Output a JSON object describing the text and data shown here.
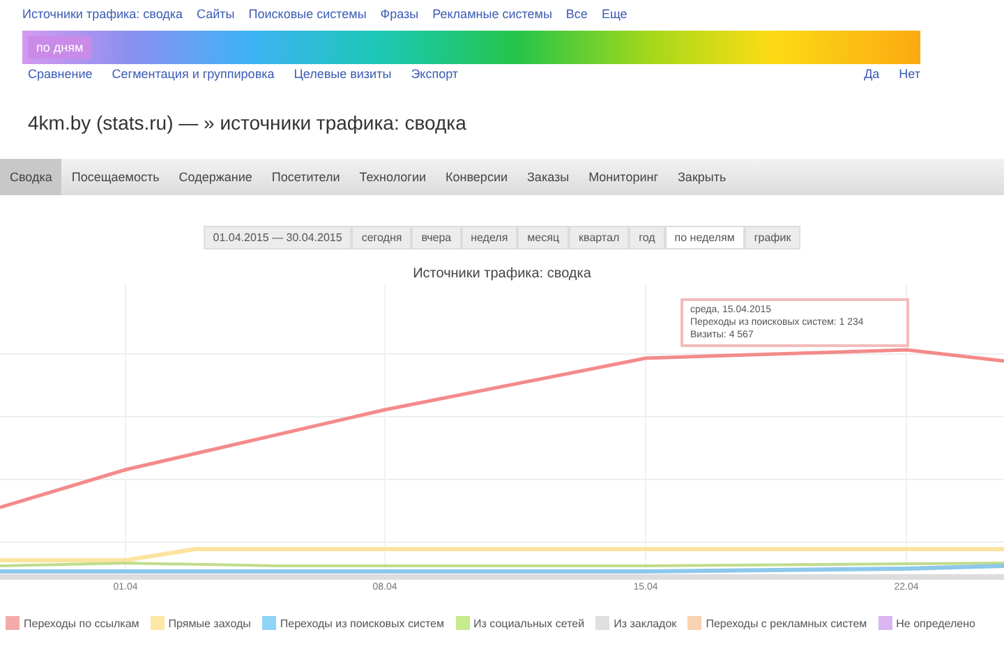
{
  "top_links": [
    "Источники трафика: сводка",
    "Сайты",
    "Поисковые системы",
    "Фразы",
    "Рекламные системы",
    "Все",
    "Еще"
  ],
  "scale_bar": {
    "label": "по дням"
  },
  "scale_links_left": [
    "Сравнение",
    "Сегментация и группировка",
    "Целевые визиты",
    "Экспорт"
  ],
  "scale_links_right": [
    "Да",
    "Нет"
  ],
  "page_title": "4km.by (stats.ru) — » источники трафика: сводка",
  "tabs": [
    {
      "label": "Сводка",
      "selected": true
    },
    {
      "label": "Посещаемость",
      "selected": false
    },
    {
      "label": "Содержание",
      "selected": false
    },
    {
      "label": "Посетители",
      "selected": false
    },
    {
      "label": "Технологии",
      "selected": false
    },
    {
      "label": "Конверсии",
      "selected": false
    },
    {
      "label": "Заказы",
      "selected": false
    },
    {
      "label": "Мониторинг",
      "selected": false
    },
    {
      "label": "Закрыть",
      "selected": false
    }
  ],
  "periods": [
    {
      "label": "01.04.2015 — 30.04.2015",
      "selected": false
    },
    {
      "label": "сегодня",
      "selected": false
    },
    {
      "label": "вчера",
      "selected": false
    },
    {
      "label": "неделя",
      "selected": false
    },
    {
      "label": "месяц",
      "selected": false
    },
    {
      "label": "квартал",
      "selected": false
    },
    {
      "label": "год",
      "selected": false
    },
    {
      "label": "по неделям",
      "selected": true
    },
    {
      "label": "график",
      "selected": false
    }
  ],
  "chart": {
    "title": "Источники трафика: сводка",
    "x_labels": [
      "01.04",
      "08.04",
      "15.04",
      "22.04"
    ],
    "tooltip": [
      "среда, 15.04.2015",
      "Переходы из поисковых систем: 1 234",
      "Визиты: 4 567"
    ]
  },
  "legend": [
    {
      "label": "Переходы по ссылкам",
      "color": "#f4aaaa"
    },
    {
      "label": "Прямые заходы",
      "color": "#fce7a6"
    },
    {
      "label": "Переходы из поисковых систем",
      "color": "#8fd3f7"
    },
    {
      "label": "Из социальных сетей",
      "color": "#c6ea8c"
    },
    {
      "label": "Из закладок",
      "color": "#e0e0e0"
    },
    {
      "label": "Переходы с рекламных систем",
      "color": "#f9d2b2"
    },
    {
      "label": "Не определено",
      "color": "#d9b5f2"
    }
  ]
}
